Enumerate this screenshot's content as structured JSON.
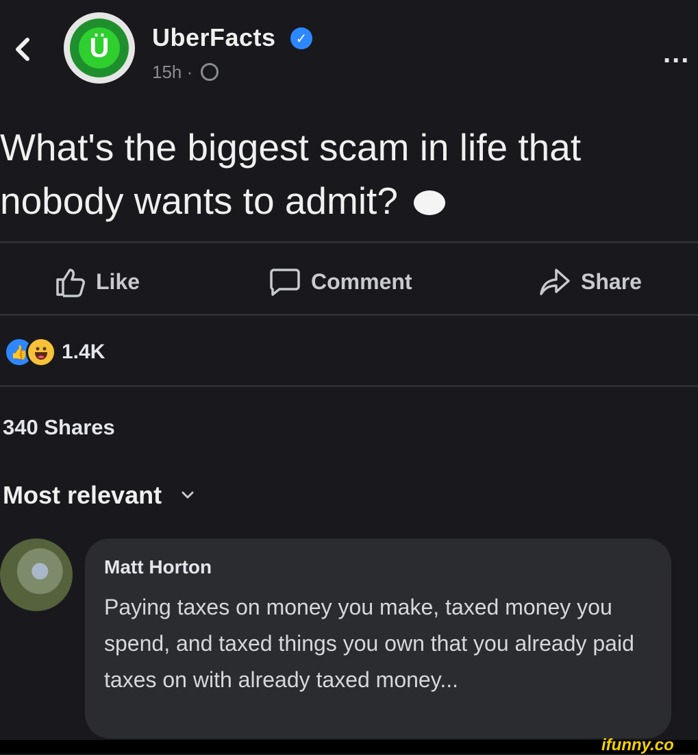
{
  "header": {
    "page_name": "UberFacts",
    "avatar_letter": "Ü",
    "time": "15h",
    "separator": "·",
    "more": "..."
  },
  "post": {
    "text": "What's the biggest scam in life that nobody wants to admit?"
  },
  "actions": {
    "like": "Like",
    "comment": "Comment",
    "share": "Share"
  },
  "stats": {
    "reaction_count": "1.4K",
    "shares": "340 Shares"
  },
  "comments": {
    "sort_label": "Most relevant",
    "items": [
      {
        "author": "Matt Horton",
        "text": "Paying taxes on money you make, taxed money you spend, and taxed things you own that you already paid taxes on with already taxed money..."
      }
    ]
  },
  "watermark": "ifunny.co",
  "colors": {
    "background": "#19191d",
    "verified_blue": "#2d88ff",
    "comment_bubble": "#2b2c30",
    "watermark_yellow": "#f5d000"
  },
  "icons": [
    "back-chevron-icon",
    "verified-badge-icon",
    "globe-icon",
    "more-icon",
    "thought-bubble-emoji-icon",
    "like-thumb-icon",
    "comment-icon",
    "share-arrow-icon",
    "like-reaction-icon",
    "haha-reaction-icon",
    "chevron-down-icon"
  ]
}
